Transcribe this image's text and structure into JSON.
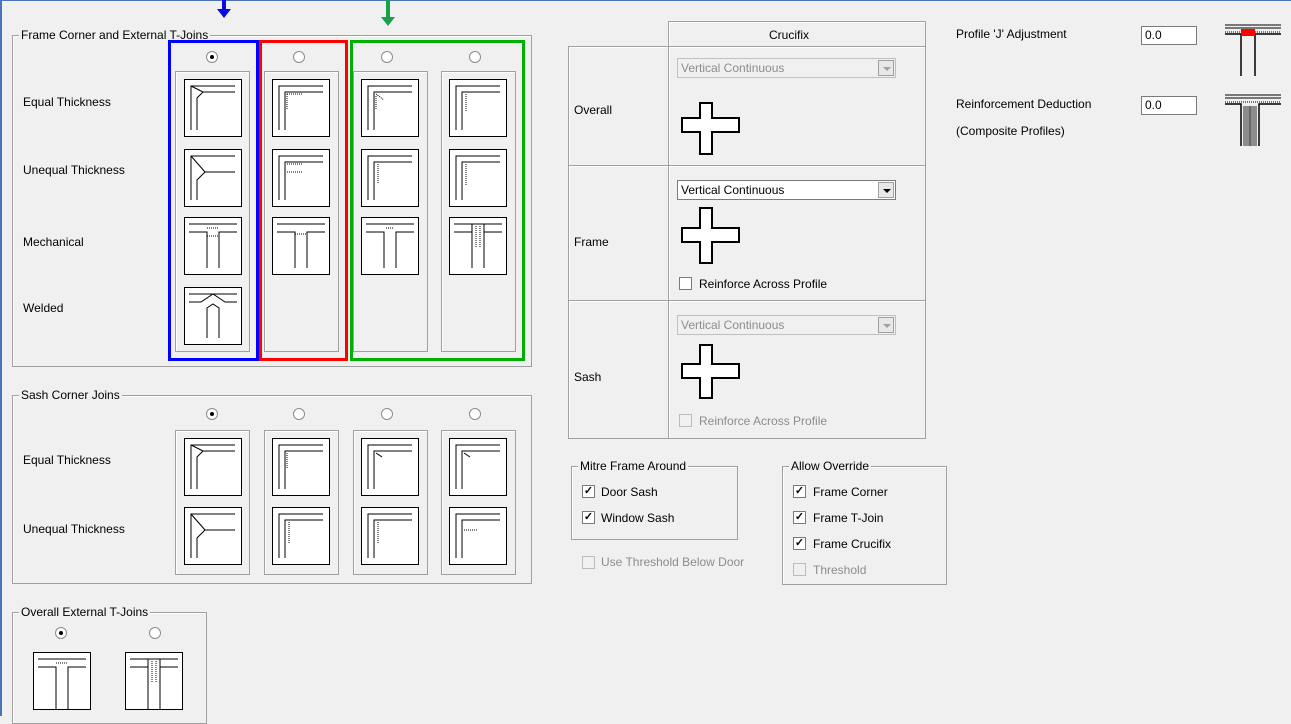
{
  "frame_group": {
    "title": "Frame Corner and External T-Joins",
    "rows": [
      "Equal Thickness",
      "Unequal Thickness",
      "Mechanical",
      "Welded"
    ],
    "selected_column": 0
  },
  "sash_group": {
    "title": "Sash Corner Joins",
    "rows": [
      "Equal Thickness",
      "Unequal Thickness"
    ],
    "selected_column": 0
  },
  "ext_group": {
    "title": "Overall External T-Joins",
    "selected_column": 0
  },
  "crucifix": {
    "header": "Crucifix",
    "rows": [
      {
        "label": "Overall",
        "combo": "Vertical Continuous",
        "combo_enabled": false
      },
      {
        "label": "Frame",
        "combo": "Vertical Continuous",
        "combo_enabled": true,
        "checkbox": "Reinforce Across Profile",
        "checkbox_enabled": true,
        "checked": false
      },
      {
        "label": "Sash",
        "combo": "Vertical Continuous",
        "combo_enabled": false,
        "checkbox": "Reinforce Across Profile",
        "checkbox_enabled": false,
        "checked": false
      }
    ]
  },
  "mitre": {
    "title": "Mitre Frame Around",
    "items": [
      {
        "label": "Door Sash",
        "checked": true
      },
      {
        "label": "Window Sash",
        "checked": true
      }
    ]
  },
  "threshold": {
    "label": "Use Threshold Below Door",
    "checked": false,
    "enabled": false
  },
  "override": {
    "title": "Allow Override",
    "items": [
      {
        "label": "Frame Corner",
        "checked": true,
        "enabled": true
      },
      {
        "label": "Frame T-Join",
        "checked": true,
        "enabled": true
      },
      {
        "label": "Frame Crucifix",
        "checked": true,
        "enabled": true
      },
      {
        "label": "Threshold",
        "checked": false,
        "enabled": false
      }
    ]
  },
  "profile_adjust": {
    "label": "Profile 'J' Adjustment",
    "value": "0.0"
  },
  "reinforcement": {
    "label_line1": "Reinforcement Deduction",
    "label_line2": "(Composite Profiles)",
    "value": "0.0"
  },
  "colors": {
    "blue": "#0000ff",
    "red": "#ff0000",
    "green": "#00b000",
    "arrow_green": "#1aa04a",
    "arrow_blue": "#0a0ae0"
  }
}
